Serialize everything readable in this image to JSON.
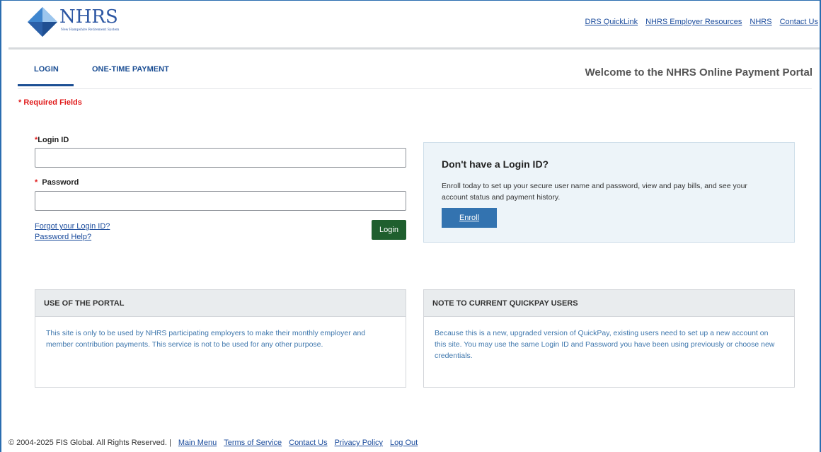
{
  "header": {
    "logo_text": "NHRS",
    "logo_subtitle": "New Hampshire Retirement System",
    "links": [
      "DRS QuickLink",
      "NHRS Employer Resources",
      "NHRS",
      "Contact Us"
    ]
  },
  "tabs": [
    {
      "label": "LOGIN",
      "active": true
    },
    {
      "label": "ONE-TIME PAYMENT",
      "active": false
    }
  ],
  "welcome": "Welcome to the NHRS Online Payment Portal",
  "required_note": "* Required Fields",
  "form": {
    "login_id_label": "Login ID",
    "login_id_value": "",
    "password_label": "Password",
    "password_value": "",
    "forgot_login_link": "Forgot your Login ID?",
    "password_help_link": "Password Help?",
    "login_button": "Login"
  },
  "enroll": {
    "title": "Don't have a Login ID?",
    "text": "Enroll today to set up your secure user name and password, view and pay bills, and see your account status and payment history.",
    "button": "Enroll"
  },
  "panels": {
    "portal": {
      "title": "USE OF THE PORTAL",
      "body": "This site is only to be used by NHRS participating employers to make their monthly employer and member contribution payments. This service is not to be used for any other purpose."
    },
    "quickpay": {
      "title": "NOTE TO CURRENT QUICKPAY USERS",
      "body": "Because this is a new, upgraded version of QuickPay, existing users need to set up a new account on this site. You may use the same Login ID and Password you have been using previously or choose new credentials."
    }
  },
  "footer": {
    "copyright": "© 2004-2025 FIS Global. All Rights Reserved.",
    "separator": "|",
    "links": [
      "Main Menu",
      "Terms of Service",
      "Contact Us",
      "Privacy Policy",
      "Log Out"
    ]
  },
  "colors": {
    "brand_blue": "#2d57a3",
    "tab_blue": "#1c4f94",
    "login_green": "#1f5f2e",
    "enroll_blue": "#3373b0",
    "required_red": "#e01b1b"
  }
}
